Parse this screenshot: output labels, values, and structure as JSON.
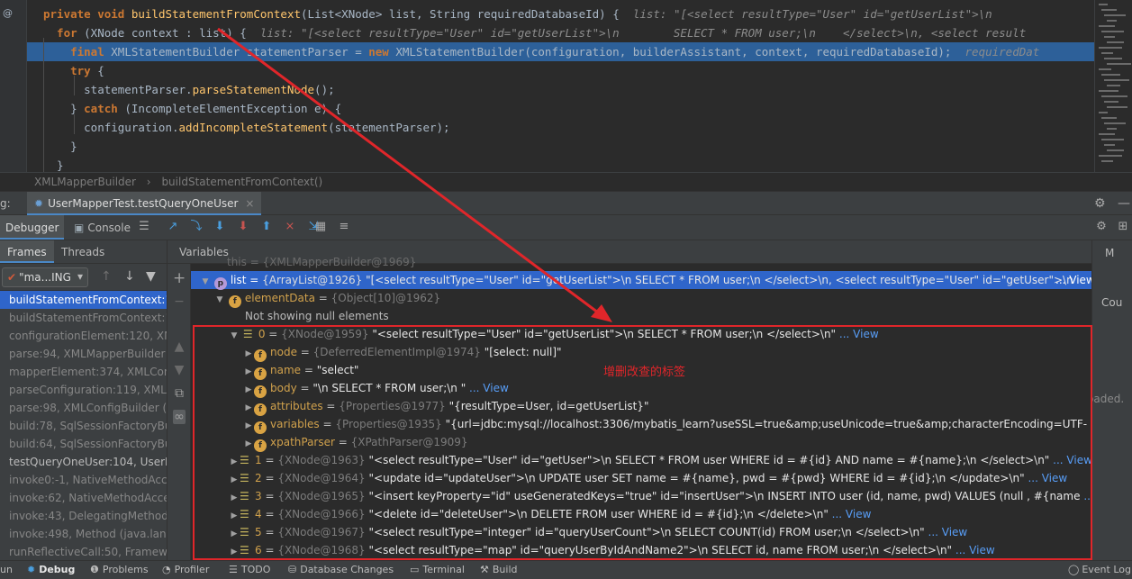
{
  "editor": {
    "gutter_mark": "@",
    "lines": [
      {
        "id": "l1",
        "parts": [
          {
            "t": "private ",
            "c": "kw"
          },
          {
            "t": "void ",
            "c": "kw"
          },
          {
            "t": "buildStatementFromContext",
            "c": "fn"
          },
          {
            "t": "(List<",
            "c": "tp"
          },
          {
            "t": "XNode",
            "c": "cls"
          },
          {
            "t": "> list, ",
            "c": "tp"
          },
          {
            "t": "String ",
            "c": "cls"
          },
          {
            "t": "requiredDatabaseId) {  ",
            "c": "tp"
          },
          {
            "t": "list: \"[<select resultType=\"User\" id=\"getUserList\">\\n",
            "c": "hint"
          }
        ]
      },
      {
        "id": "l2",
        "parts": [
          {
            "t": "  for ",
            "c": "kw"
          },
          {
            "t": "(XNode context : list) {  ",
            "c": "tp"
          },
          {
            "t": "list: \"[<select resultType=\"User\" id=\"getUserList\">\\n        SELECT * FROM user;\\n    </select>\\n, <select result",
            "c": "hint"
          }
        ]
      },
      {
        "id": "l3",
        "parts": [
          {
            "t": "    final ",
            "c": "kw"
          },
          {
            "t": "XMLStatementBuilder statementParser = ",
            "c": "tp"
          },
          {
            "t": "new ",
            "c": "kw"
          },
          {
            "t": "XMLStatementBuilder(configuration, builderAssistant, context, requiredDatabaseId);  ",
            "c": "tp"
          },
          {
            "t": "requiredDat",
            "c": "hint"
          }
        ]
      },
      {
        "id": "l4",
        "parts": [
          {
            "t": "    try ",
            "c": "kw"
          },
          {
            "t": "{",
            "c": "tp"
          }
        ]
      },
      {
        "id": "l5",
        "parts": [
          {
            "t": "      statementParser.",
            "c": "tp"
          },
          {
            "t": "parseStatementNode",
            "c": "meth"
          },
          {
            "t": "();",
            "c": "tp"
          }
        ]
      },
      {
        "id": "l6",
        "parts": [
          {
            "t": "    } ",
            "c": "tp"
          },
          {
            "t": "catch ",
            "c": "kw"
          },
          {
            "t": "(IncompleteElementException e) {",
            "c": "tp"
          }
        ]
      },
      {
        "id": "l7",
        "parts": [
          {
            "t": "      configuration.",
            "c": "tp"
          },
          {
            "t": "addIncompleteStatement",
            "c": "meth"
          },
          {
            "t": "(statementParser);",
            "c": "tp"
          }
        ]
      },
      {
        "id": "l8",
        "parts": [
          {
            "t": "    }",
            "c": "tp"
          }
        ]
      },
      {
        "id": "l9",
        "parts": [
          {
            "t": "  }",
            "c": "tp"
          }
        ]
      }
    ]
  },
  "breadcrumb": {
    "class": "XMLMapperBuilder",
    "method": "buildStatementFromContext()"
  },
  "debug_bar": {
    "prefix": "g:",
    "session_tab": "UserMapperTest.testQueryOneUser",
    "tab_debugger": "Debugger",
    "tab_console": "Console"
  },
  "frames": {
    "tab_frames": "Frames",
    "tab_threads": "Threads",
    "thread_label": "\"ma...ING",
    "items": [
      {
        "text": "buildStatementFromContext:13",
        "state": "active"
      },
      {
        "text": "buildStatementFromContext:13",
        "state": ""
      },
      {
        "text": "configurationElement:120, XMl",
        "state": ""
      },
      {
        "text": "parse:94, XMLMapperBuilder",
        "state": ""
      },
      {
        "text": "mapperElement:374, XMLConf",
        "state": ""
      },
      {
        "text": "parseConfiguration:119, XMLC",
        "state": ""
      },
      {
        "text": "parse:98, XMLConfigBuilder (c",
        "state": ""
      },
      {
        "text": "build:78, SqlSessionFactoryBu",
        "state": ""
      },
      {
        "text": "build:64, SqlSessionFactoryBu",
        "state": ""
      },
      {
        "text": "testQueryOneUser:104, UserM",
        "state": "bright"
      },
      {
        "text": "invoke0:-1, NativeMethodAcce",
        "state": ""
      },
      {
        "text": "invoke:62, NativeMethodAcces",
        "state": ""
      },
      {
        "text": "invoke:43, DelegatingMethodA",
        "state": ""
      },
      {
        "text": "invoke:498, Method (java.lang",
        "state": ""
      },
      {
        "text": "runReflectiveCall:50, Framewo",
        "state": ""
      }
    ]
  },
  "variables": {
    "header": "Variables",
    "partial_top": "this = {XMLMapperBuilder@1969}",
    "list_row": {
      "name": "list",
      "type": "{ArrayList@1926}",
      "value": "\"[<select resultType=\"User\" id=\"getUserList\">\\n       SELECT * FROM user;\\n    </select>\\n, <select resultType=\"User\" id=\"getUser\">\\n  ",
      "view": "... View"
    },
    "element_data": {
      "name": "elementData",
      "type": "{Object[10]@1962}"
    },
    "null_note": "Not showing null elements",
    "item0": {
      "name": "0",
      "type": "{XNode@1959}",
      "value": "\"<select resultType=\"User\" id=\"getUserList\">\\n       SELECT * FROM user;\\n    </select>\\n\"",
      "view": "... View"
    },
    "fields": [
      {
        "name": "node",
        "type": "{DeferredElementImpl@1974}",
        "value": "\"[select: null]\"",
        "view": ""
      },
      {
        "name": "name",
        "type": "",
        "value": "\"select\"",
        "view": ""
      },
      {
        "name": "body",
        "type": "",
        "value": "\"\\n        SELECT * FROM user;\\n    \"",
        "view": "... View"
      },
      {
        "name": "attributes",
        "type": "{Properties@1977}",
        "value": "\"{resultType=User, id=getUserList}\"",
        "view": ""
      },
      {
        "name": "variables",
        "type": "{Properties@1935}",
        "value": "\"{url=jdbc:mysql://localhost:3306/mybatis_learn?useSSL=true&amp;useUnicode=true&amp;characterEncoding=UTF-",
        "view": "... View"
      },
      {
        "name": "xpathParser",
        "type": "{XPathParser@1909}",
        "value": "",
        "view": ""
      }
    ],
    "items": [
      {
        "name": "1",
        "type": "{XNode@1963}",
        "value": "\"<select resultType=\"User\" id=\"getUser\">\\n       SELECT * FROM user WHERE id = #{id} AND name = #{name};\\n    </select>\\n\"",
        "view": "... View"
      },
      {
        "name": "2",
        "type": "{XNode@1964}",
        "value": "\"<update id=\"updateUser\">\\n       UPDATE user SET name = #{name}, pwd = #{pwd} WHERE id = #{id};\\n    </update>\\n\"",
        "view": "... View"
      },
      {
        "name": "3",
        "type": "{XNode@1965}",
        "value": "\"<insert keyProperty=\"id\" useGeneratedKeys=\"true\" id=\"insertUser\">\\n       INSERT INTO user (id, name, pwd) VALUES (null , #{name",
        "view": "... View"
      },
      {
        "name": "4",
        "type": "{XNode@1966}",
        "value": "\"<delete id=\"deleteUser\">\\n       DELETE FROM user WHERE id = #{id};\\n    </delete>\\n\"",
        "view": "... View"
      },
      {
        "name": "5",
        "type": "{XNode@1967}",
        "value": "\"<select resultType=\"integer\" id=\"queryUserCount\">\\n       SELECT COUNT(id) FROM user;\\n    </select>\\n\"",
        "view": "... View"
      },
      {
        "name": "6",
        "type": "{XNode@1968}",
        "value": "\"<select resultType=\"map\" id=\"queryUserByIdAndName2\">\\n       SELECT id, name FROM user;\\n    </select>\\n\"",
        "view": "... View"
      }
    ],
    "annotation": "增删改查的标签"
  },
  "right_panel": {
    "m": "M",
    "cou": "Cou",
    "loaded": "oaded."
  },
  "statusbar": {
    "items": [
      "un",
      "Debug",
      "Problems",
      "Profiler",
      "TODO",
      "Database Changes",
      "Terminal",
      "Build"
    ],
    "event_log": "Event Log"
  },
  "colors": {
    "accent": "#2f65ca",
    "annotation": "#e0262a",
    "keyword": "#cc7832",
    "function": "#ffc66d"
  }
}
